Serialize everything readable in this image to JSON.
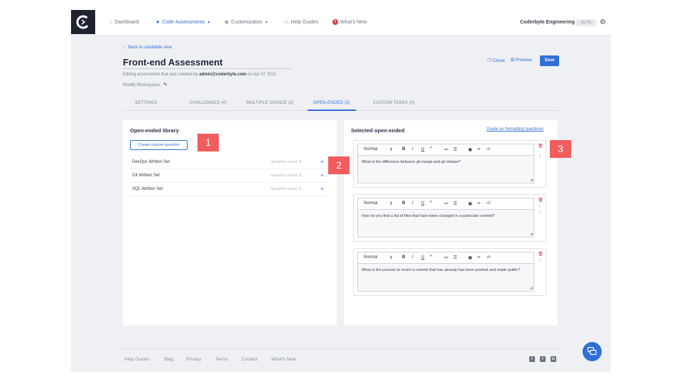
{
  "nav": {
    "items": [
      {
        "icon": "home-icon",
        "glyph": "⌂",
        "label": "Dashboard"
      },
      {
        "icon": "star-icon",
        "glyph": "★",
        "label": "Code Assessments"
      },
      {
        "icon": "palette-icon",
        "glyph": "◉",
        "label": "Customization"
      },
      {
        "icon": "book-icon",
        "glyph": "▭",
        "label": "Help Guides"
      },
      {
        "icon": "news-icon",
        "glyph": "5",
        "label": "What's New"
      }
    ],
    "org": "Coderbyte Engineering",
    "tier": "ELITE"
  },
  "header": {
    "back": "← Back to candidate view",
    "title": "Front-end Assessment",
    "subtitle_prefix": "Editing assessment that was created by ",
    "subtitle_email": "admin@coderbyte.com",
    "subtitle_suffix": " on Apr 07 2021",
    "modify_label": "Modify Workspaces:",
    "clone": "Clone",
    "preview": "Preview",
    "save": "Save"
  },
  "tabs": [
    "SETTINGS",
    "CHALLENGES (4)",
    "MULTIPLE CHOICE (2)",
    "OPEN-ENDED (3)",
    "CUSTOM TASKS (0)"
  ],
  "library": {
    "title": "Open-ended library",
    "create_button": "Create custom question",
    "rows": [
      {
        "name": "DevOps Written Set",
        "count": "Question count: 5"
      },
      {
        "name": "Git Written Set",
        "count": "Question count: 5"
      },
      {
        "name": "SQL Written Set",
        "count": "Question count: 6"
      }
    ]
  },
  "selected": {
    "title": "Selected open-ended",
    "guide_link": "Guide on formatting questions",
    "format_label": "Normal",
    "questions": [
      "What is the difference between git merge and git rebase?",
      "How do you find a list of files that have been changed in a particular commit?",
      "What is the process to revert a commit that has already has been pushed and made public?"
    ]
  },
  "callouts": [
    "1",
    "2",
    "3"
  ],
  "footer": {
    "links": [
      "Help Guides",
      "Blog",
      "Privacy",
      "Terms",
      "Contact",
      "What's New"
    ],
    "social": [
      "f",
      "t",
      "in"
    ]
  },
  "colors": {
    "accent": "#2f6fd6",
    "callout": "#f25c5c",
    "danger": "#e0394a"
  }
}
